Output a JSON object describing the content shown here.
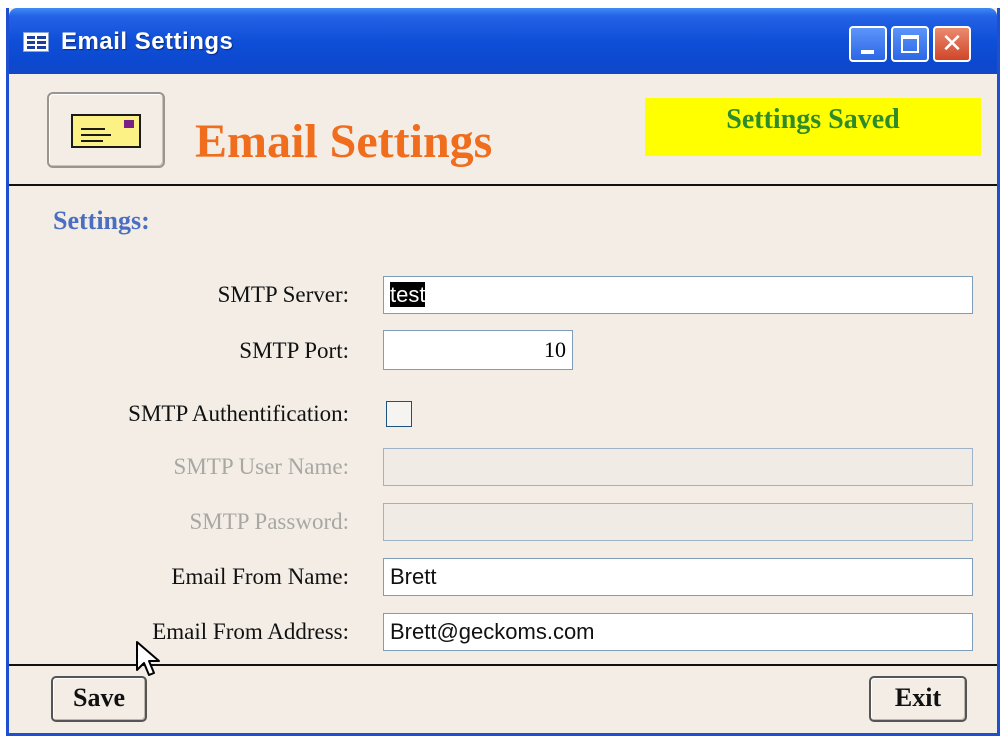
{
  "window": {
    "title": "Email  Settings"
  },
  "header": {
    "title": "Email Settings",
    "status": "Settings Saved"
  },
  "settings": {
    "section_label": "Settings:",
    "smtp_server": {
      "label": "SMTP Server:",
      "value": "test"
    },
    "smtp_port": {
      "label": "SMTP Port:",
      "value": "10"
    },
    "smtp_auth": {
      "label": "SMTP Authentification:",
      "checked": false
    },
    "smtp_user": {
      "label": "SMTP User Name:",
      "value": ""
    },
    "smtp_password": {
      "label": "SMTP Password:",
      "value": ""
    },
    "from_name": {
      "label": "Email From Name:",
      "value": "Brett"
    },
    "from_address": {
      "label": "Email From Address:",
      "value": "Brett@geckoms.com"
    }
  },
  "footer": {
    "save_label": "Save",
    "exit_label": "Exit"
  },
  "colors": {
    "title_accent": "#ef6d1c",
    "status_bg": "#ffff00",
    "status_text": "#2e8b2a",
    "section_label": "#4a6fc2",
    "titlebar": "#0f4fd8"
  },
  "icons": {
    "window_icon": "form-icon",
    "header_icon": "envelope-icon",
    "minimize": "minimize-icon",
    "maximize": "maximize-icon",
    "close": "close-icon",
    "pointer": "mouse-pointer-icon"
  }
}
